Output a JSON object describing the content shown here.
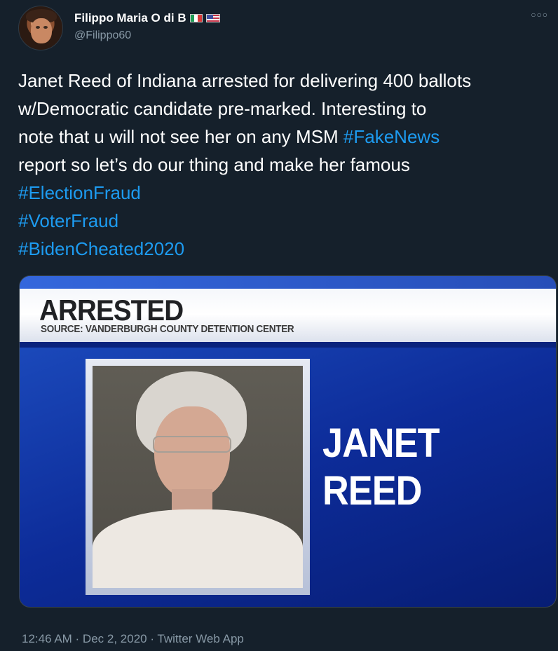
{
  "author": {
    "name": "Filippo Maria O di B",
    "handle": "@Filippo60",
    "flags": [
      "italy-flag",
      "us-flag"
    ]
  },
  "icons": {
    "more": "more-icon"
  },
  "tweet": {
    "text": {
      "line1": "Janet Reed of Indiana arrested for delivering 400 ballots",
      "line2": "w/Democratic candidate pre-marked. Interesting to",
      "line3_prefix": "note that u will not see her on any MSM ",
      "hashtag_fake_news": "#FakeNews",
      "line4": "report so let’s do our thing and make her famous",
      "hashtag_election_fraud": "#ElectionFraud",
      "hashtag_voter_fraud": "#VoterFraud",
      "hashtag_biden": "#BidenCheated2020"
    },
    "timestamp": "12:46 AM · Dec 2, 2020 · Twitter Web App"
  },
  "media": {
    "headline": "ARRESTED",
    "source": "SOURCE: VANDERBURGH COUNTY DETENTION CENTER",
    "name_line1": "JANET",
    "name_line2": "REED"
  },
  "colors": {
    "background": "#15202b",
    "text": "#ffffff",
    "secondary": "#8899a6",
    "link": "#1d9bf0",
    "news_blue": "#1f52c5"
  }
}
